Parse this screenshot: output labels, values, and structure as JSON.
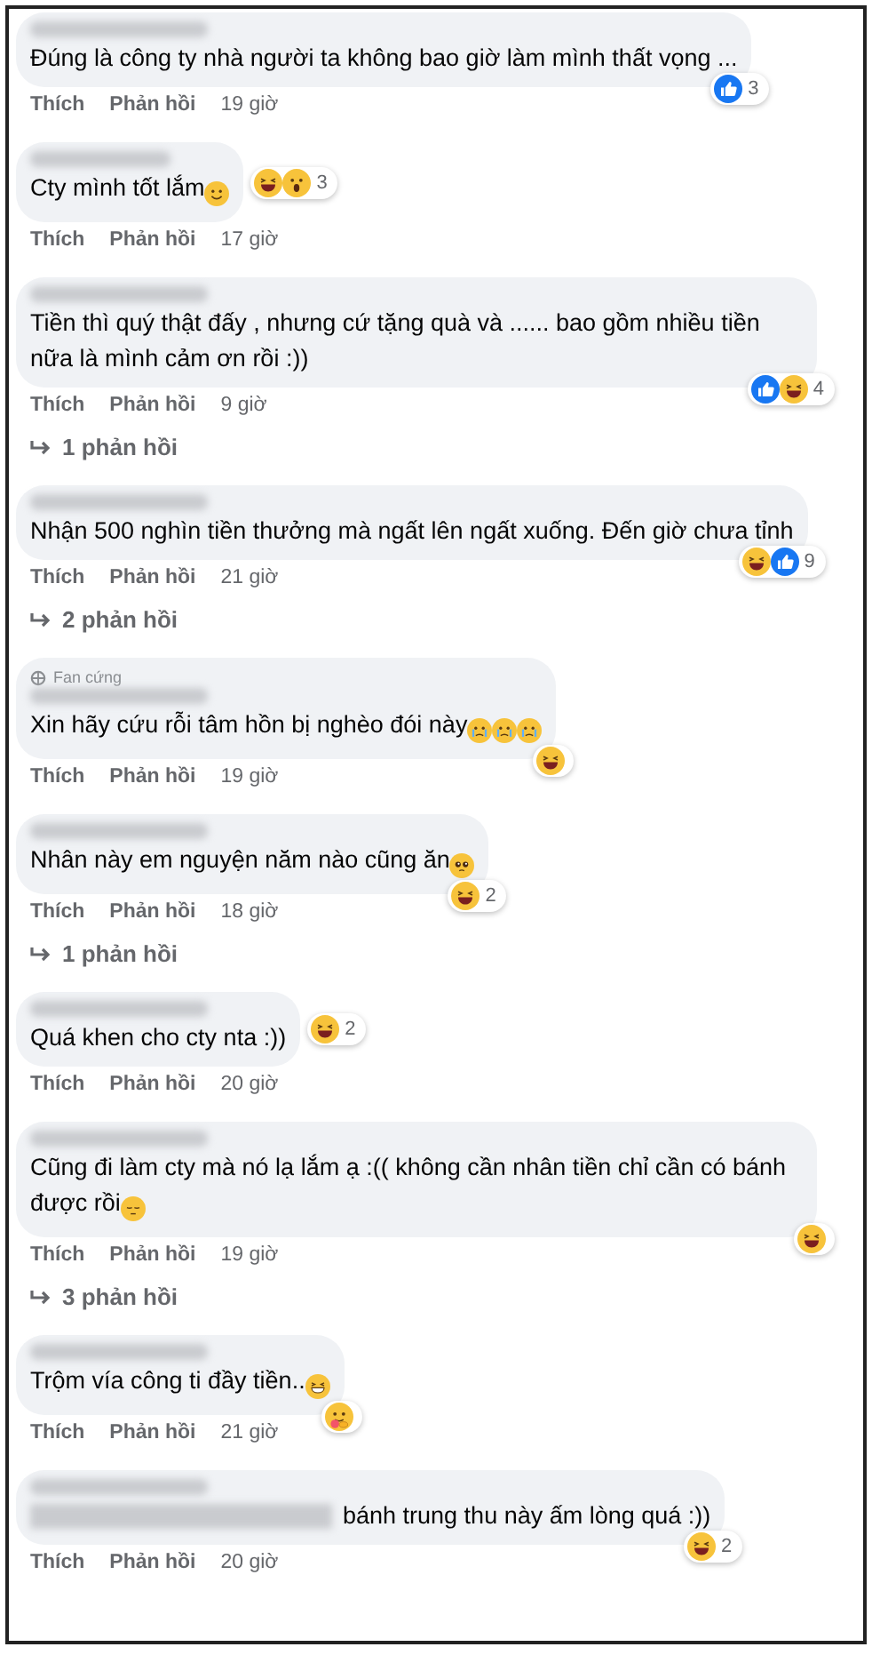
{
  "comments": [
    {
      "text": "Đúng là công ty nhà người ta không bao giờ làm mình thất vọng ...",
      "reactions": {
        "kind": "corner",
        "icons": [
          {
            "kind": "like"
          }
        ],
        "count": "3"
      },
      "like": "Thích",
      "reply": "Phản hồi",
      "time": "19 giờ"
    },
    {
      "text": "Cty mình tốt lắm",
      "emojis": [
        {
          "kind": "smile"
        }
      ],
      "reactions": {
        "kind": "inline",
        "icons": [
          {
            "kind": "haha"
          },
          {
            "kind": "wow"
          }
        ],
        "count": "3"
      },
      "like": "Thích",
      "reply": "Phản hồi",
      "time": "17 giờ"
    },
    {
      "text": "Tiền thì quý thật đấy , nhưng cứ tặng quà và ...... bao gồm nhiều tiền nữa là mình cảm ơn rồi :))",
      "reactions": {
        "kind": "corner",
        "icons": [
          {
            "kind": "like"
          },
          {
            "kind": "haha"
          }
        ],
        "count": "4"
      },
      "like": "Thích",
      "reply": "Phản hồi",
      "time": "9 giờ",
      "replies": "1 phản hồi"
    },
    {
      "text": "Nhận 500 nghìn tiền thưởng mà ngất lên ngất xuống. Đến giờ chưa tỉnh",
      "reactions": {
        "kind": "corner",
        "icons": [
          {
            "kind": "haha"
          },
          {
            "kind": "like"
          }
        ],
        "count": "9"
      },
      "like": "Thích",
      "reply": "Phản hồi",
      "time": "21 giờ",
      "replies": "2 phản hồi"
    },
    {
      "badge": "Fan cứng",
      "text": "Xin hãy cứu rỗi tâm hồn bị nghèo đói này",
      "emojis": [
        {
          "kind": "cry"
        },
        {
          "kind": "cry"
        },
        {
          "kind": "cry"
        }
      ],
      "reactions": {
        "kind": "corner",
        "icons": [
          {
            "kind": "haha"
          }
        ]
      },
      "like": "Thích",
      "reply": "Phản hồi",
      "time": "19 giờ"
    },
    {
      "text": "Nhân này em nguyện năm nào cũng ăn",
      "emojis": [
        {
          "kind": "pleading"
        }
      ],
      "reactions": {
        "kind": "corner",
        "icons": [
          {
            "kind": "haha"
          }
        ],
        "count": "2"
      },
      "like": "Thích",
      "reply": "Phản hồi",
      "time": "18 giờ",
      "replies": "1 phản hồi"
    },
    {
      "text": "Quá khen cho cty nta :))",
      "reactions": {
        "kind": "inline",
        "icons": [
          {
            "kind": "haha"
          }
        ],
        "count": "2"
      },
      "like": "Thích",
      "reply": "Phản hồi",
      "time": "20 giờ"
    },
    {
      "text": "Cũng đi làm cty mà nó lạ lắm ạ :(( không cần nhân tiền chỉ cần có bánh được rồi",
      "emojis": [
        {
          "kind": "pensive"
        }
      ],
      "reactions": {
        "kind": "corner",
        "icons": [
          {
            "kind": "haha"
          }
        ]
      },
      "like": "Thích",
      "reply": "Phản hồi",
      "time": "19 giờ",
      "replies": "3 phản hồi"
    },
    {
      "text": "Trộm vía công ti đầy tiền..",
      "emojis": [
        {
          "kind": "grin"
        }
      ],
      "reactions": {
        "kind": "corner",
        "icons": [
          {
            "kind": "care"
          }
        ]
      },
      "like": "Thích",
      "reply": "Phản hồi",
      "time": "21 giờ"
    },
    {
      "blurred_prefix": true,
      "text": "bánh trung thu này ấm lòng quá :))",
      "reactions": {
        "kind": "corner",
        "icons": [
          {
            "kind": "haha"
          }
        ],
        "count": "2"
      },
      "like": "Thích",
      "reply": "Phản hồi",
      "time": "20 giờ"
    }
  ]
}
